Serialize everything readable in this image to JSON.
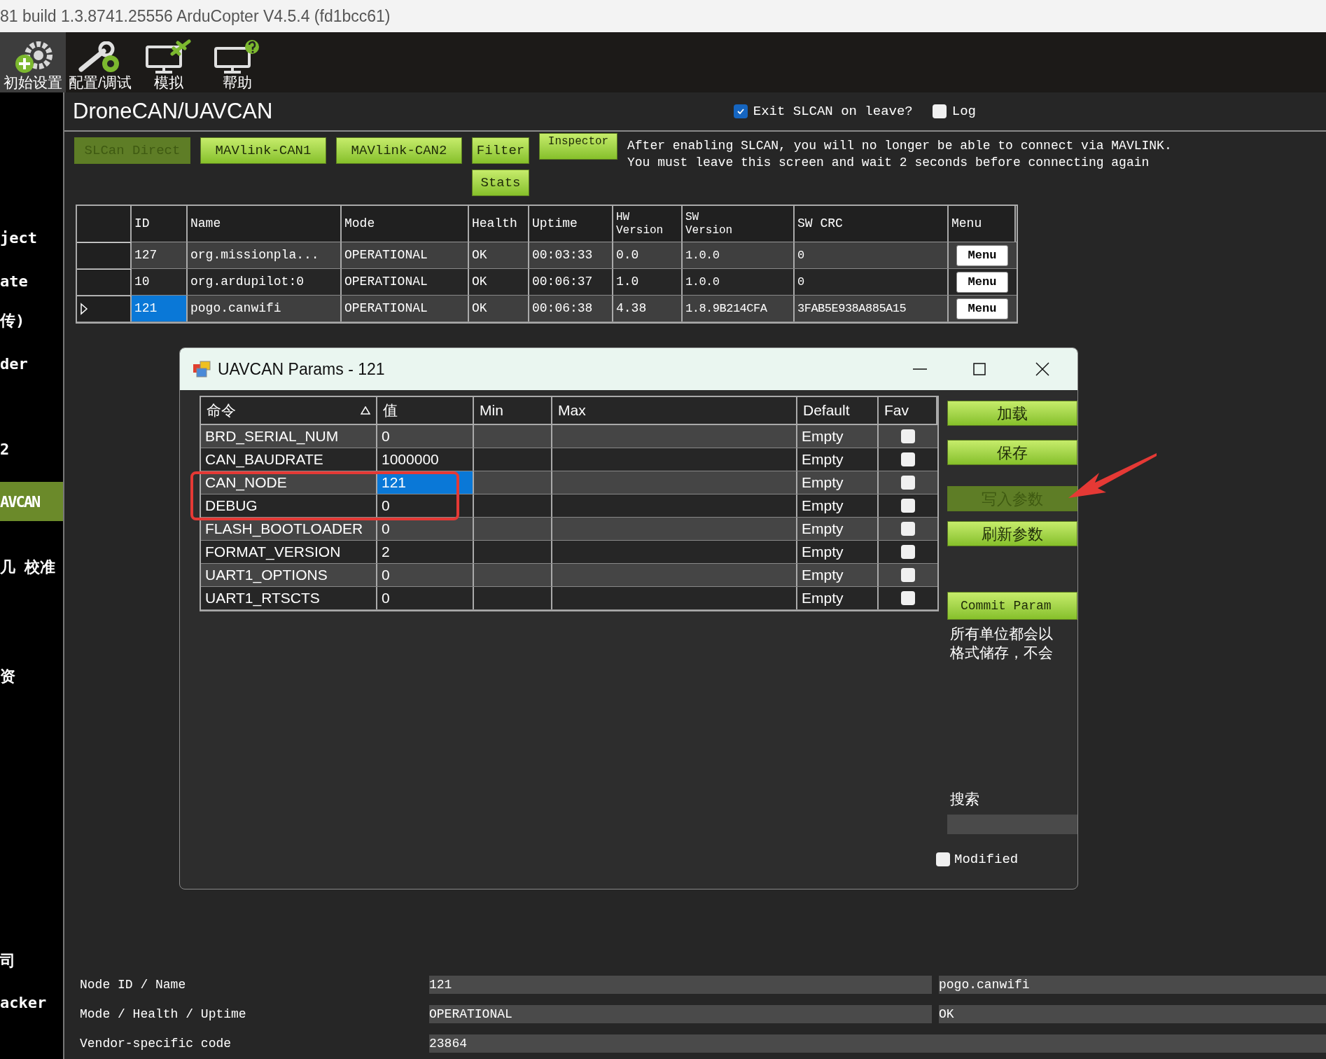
{
  "window": {
    "title": "81 build 1.3.8741.25556 ArduCopter V4.5.4 (fd1bcc61)"
  },
  "toolbar": [
    {
      "label": "初始设置",
      "kind": "gear",
      "selected": true
    },
    {
      "label": "配置/调试",
      "kind": "wrench",
      "selected": false
    },
    {
      "label": "模拟",
      "kind": "plane",
      "selected": false
    },
    {
      "label": "帮助",
      "kind": "help",
      "selected": false
    }
  ],
  "sidebar": {
    "items": [
      {
        "label": "ject",
        "selected": false
      },
      {
        "label": "ate",
        "selected": false
      },
      {
        "label": "传)",
        "selected": false
      },
      {
        "label": "der",
        "selected": false
      },
      {
        "label": "2",
        "selected": false
      },
      {
        "label": "AVCAN",
        "selected": true
      },
      {
        "label": "几 校准",
        "selected": false
      },
      {
        "label": "资",
        "selected": false
      },
      {
        "label": "司",
        "selected": false
      },
      {
        "label": "acker",
        "selected": false
      }
    ]
  },
  "page": {
    "title": "DroneCAN/UAVCAN",
    "exit_slcan": {
      "label": "Exit SLCAN on leave?",
      "checked": true
    },
    "log": {
      "label": "Log",
      "checked": false
    },
    "buttons": [
      {
        "label": "SLCan Direct",
        "disabled": true
      },
      {
        "label": "MAVlink-CAN1",
        "disabled": false
      },
      {
        "label": "MAVlink-CAN2",
        "disabled": false
      }
    ],
    "filter_button": "Filter",
    "stats_button": "Stats",
    "inspector_button": "Inspector",
    "notice": [
      "After enabling SLCAN, you will no longer be able to connect via MAVLINK.",
      "You must leave this screen and wait 2 seconds before connecting again"
    ]
  },
  "nodes": {
    "columns": [
      "ID",
      "Name",
      "Mode",
      "Health",
      "Uptime",
      "HW\nVersion",
      "SW\nVersion",
      "SW CRC",
      "Menu"
    ],
    "rows": [
      {
        "cells": [
          "127",
          "org.missionpla...",
          "OPERATIONAL",
          "OK",
          "00:03:33",
          "0.0",
          "1.0.0",
          "0"
        ],
        "menu": "Menu",
        "selected": false
      },
      {
        "cells": [
          "10",
          "org.ardupilot:0",
          "OPERATIONAL",
          "OK",
          "00:06:37",
          "1.0",
          "1.0.0",
          "0"
        ],
        "menu": "Menu",
        "selected": false
      },
      {
        "cells": [
          "121",
          "pogo.canwifi",
          "OPERATIONAL",
          "OK",
          "00:06:38",
          "4.38",
          "1.8.9B214CFA",
          "3FAB5E938A885A15"
        ],
        "menu": "Menu",
        "selected": true
      }
    ]
  },
  "dialog": {
    "title": "UAVCAN Params - 121",
    "columns": [
      {
        "label": "命令",
        "sorted": true
      },
      {
        "label": "值",
        "sorted": false
      },
      {
        "label": "Min",
        "sorted": false
      },
      {
        "label": "Max",
        "sorted": false
      },
      {
        "label": "Default",
        "sorted": false
      },
      {
        "label": "Fav",
        "sorted": false
      }
    ],
    "rows": [
      {
        "name": "BRD_SERIAL_NUM",
        "value": "0",
        "default": "Empty",
        "fav": false,
        "selected": false
      },
      {
        "name": "CAN_BAUDRATE",
        "value": "1000000",
        "default": "Empty",
        "fav": false,
        "selected": false
      },
      {
        "name": "CAN_NODE",
        "value": "121",
        "default": "Empty",
        "fav": false,
        "selected": true
      },
      {
        "name": "DEBUG",
        "value": "0",
        "default": "Empty",
        "fav": false,
        "selected": false
      },
      {
        "name": "FLASH_BOOTLOADER",
        "value": "0",
        "default": "Empty",
        "fav": false,
        "selected": false
      },
      {
        "name": "FORMAT_VERSION",
        "value": "2",
        "default": "Empty",
        "fav": false,
        "selected": false
      },
      {
        "name": "UART1_OPTIONS",
        "value": "0",
        "default": "Empty",
        "fav": false,
        "selected": false
      },
      {
        "name": "UART1_RTSCTS",
        "value": "0",
        "default": "Empty",
        "fav": false,
        "selected": false
      }
    ],
    "buttons": [
      {
        "label": "加载",
        "disabled": false
      },
      {
        "label": "保存",
        "disabled": false
      },
      {
        "label": "写入参数",
        "disabled": true
      },
      {
        "label": "刷新参数",
        "disabled": false
      }
    ],
    "commit_button": "Commit Param",
    "note": [
      "所有单位都会以",
      "格式储存，不会"
    ],
    "search_label": "搜索",
    "modified": {
      "label": "Modified",
      "checked": false
    }
  },
  "details": [
    {
      "label": "Node ID / Name",
      "values": [
        "121",
        "pogo.canwifi"
      ]
    },
    {
      "label": "Mode / Health / Uptime",
      "values": [
        "OPERATIONAL",
        "OK"
      ]
    },
    {
      "label": "Vendor-specific code",
      "values": [
        "23864"
      ]
    }
  ]
}
